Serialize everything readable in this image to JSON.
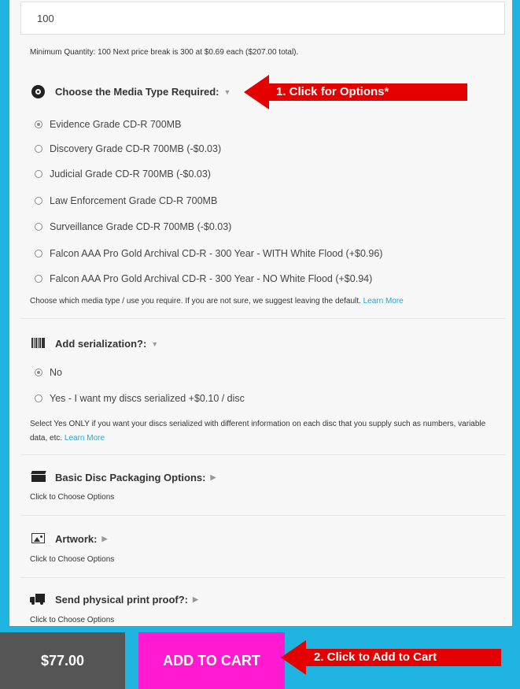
{
  "quantity": {
    "value": "100",
    "note": "Minimum Quantity: 100  Next price break is 300 at $0.69 each ($207.00 total)."
  },
  "media": {
    "title": "Choose the Media Type Required:",
    "icon": "disc-icon",
    "options": [
      "Evidence Grade CD-R 700MB",
      "Discovery Grade CD-R 700MB (-$0.03)",
      "Judicial Grade CD-R 700MB (-$0.03)",
      "Law Enforcement Grade CD-R 700MB",
      "Surveillance Grade CD-R 700MB (-$0.03)",
      "Falcon AAA Pro Gold Archival CD-R - 300 Year - WITH White Flood (+$0.96)",
      "Falcon AAA Pro Gold Archival CD-R - 300 Year - NO White Flood (+$0.94)"
    ],
    "selected": "Evidence Grade CD-R 700MB",
    "help": "Choose which media type / use you require. If you are not sure, we suggest leaving the default.",
    "learn_more": "Learn More"
  },
  "serial": {
    "title": "Add serialization?:",
    "icon": "barcode-icon",
    "options": [
      "No",
      "Yes - I want my discs serialized +$0.10 / disc"
    ],
    "selected": "No",
    "help": "Select Yes ONLY if you want your discs serialized with different information on each disc that you supply such as numbers, variable data, etc.",
    "learn_more": "Learn More"
  },
  "packaging": {
    "title": "Basic Disc Packaging Options:",
    "icon": "clapper-icon",
    "sub": "Click to Choose Options"
  },
  "artwork": {
    "title": "Artwork:",
    "icon": "image-icon",
    "sub": "Click to Choose Options"
  },
  "proof": {
    "title": "Send physical print proof?:",
    "icon": "truck-icon",
    "sub": "Click to Choose Options"
  },
  "callouts": {
    "one": "1. Click for Options*",
    "two": "2. Click to Add to Cart"
  },
  "footer": {
    "price": "$77.00",
    "add_to_cart": "ADD TO CART"
  },
  "colors": {
    "background": "#1fb3e0",
    "callout": "#e50000",
    "cart_button": "#ff1ad1",
    "price_box": "#555555",
    "link": "#1fa8dc"
  }
}
